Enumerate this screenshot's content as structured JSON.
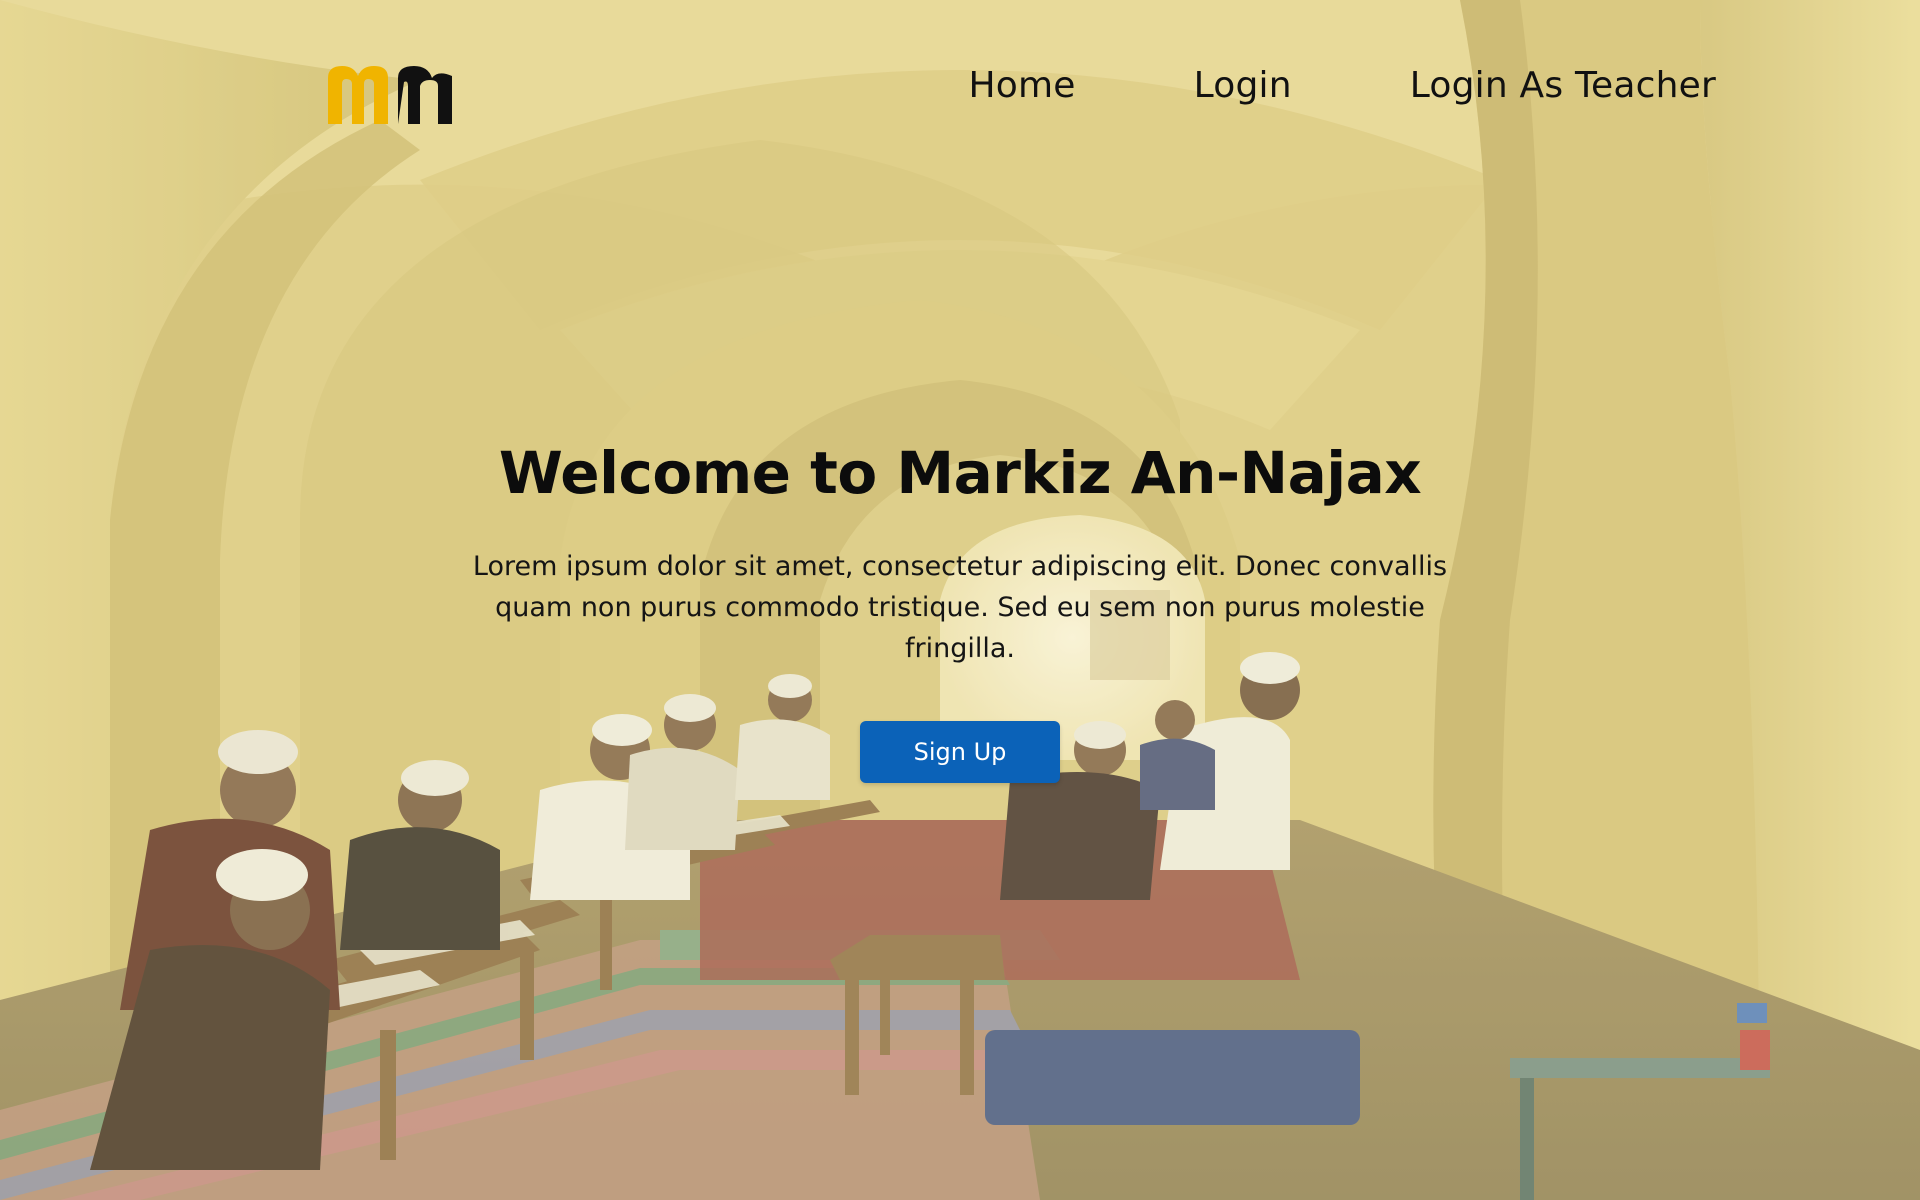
{
  "brand": {
    "logo_text": "mn",
    "logo_colors": {
      "primary": "#f0b400",
      "secondary": "#111111"
    }
  },
  "nav": {
    "items": [
      {
        "label": "Home"
      },
      {
        "label": "Login"
      },
      {
        "label": "Login As Teacher"
      }
    ]
  },
  "hero": {
    "title": "Welcome to Markiz An-Najax",
    "description": "Lorem ipsum dolor sit amet, consectetur adipiscing elit. Donec convallis quam non purus commodo tristique. Sed eu sem non purus molestie fringilla.",
    "cta_label": "Sign Up"
  },
  "background": {
    "subject": "madrasa students reading under arched corridor",
    "overlay_color": "#e8d98a"
  },
  "colors": {
    "accent": "#0b62b8",
    "text": "#111111"
  }
}
